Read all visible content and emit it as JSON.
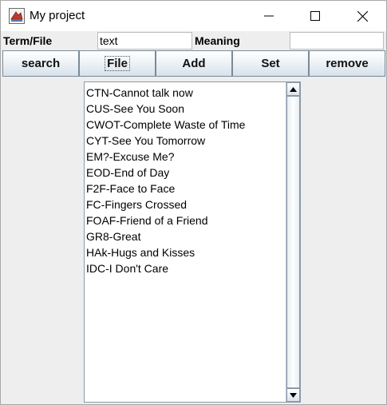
{
  "window": {
    "title": "My project",
    "app_icon": "java-cup-icon",
    "controls": [
      "minimize-icon",
      "maximize-icon",
      "close-icon"
    ]
  },
  "form": {
    "term_label": "Term/File",
    "term_value": "text",
    "meaning_label": "Meaning",
    "meaning_value": ""
  },
  "toolbar": {
    "search_label": "search",
    "file_label": "File",
    "add_label": "Add",
    "set_label": "Set",
    "remove_label": "remove"
  },
  "list": {
    "items": [
      "CTN-Cannot talk now",
      "CUS-See You Soon",
      "CWOT-Complete Waste of Time",
      "CYT-See You Tomorrow",
      "EM?-Excuse Me?",
      "EOD-End of Day",
      "F2F-Face to Face",
      "FC-Fingers Crossed",
      "FOAF-Friend of a Friend",
      "GR8-Great",
      "HAk-Hugs and Kisses",
      "IDC-I Don't Care"
    ],
    "scroll_icons": [
      "scroll-up-arrow-icon",
      "scroll-down-arrow-icon"
    ]
  }
}
